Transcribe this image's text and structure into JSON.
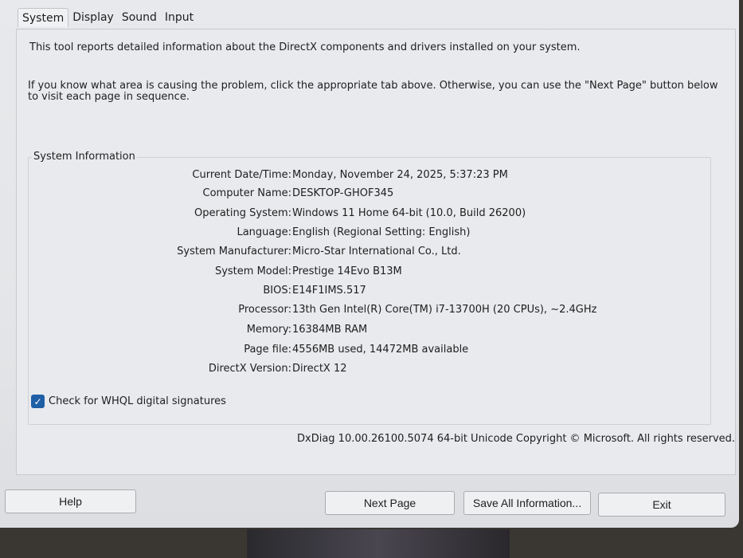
{
  "tabs": [
    {
      "label": "System"
    },
    {
      "label": "Display"
    },
    {
      "label": "Sound"
    },
    {
      "label": "Input"
    }
  ],
  "intro": {
    "line1": "This tool reports detailed information about the DirectX components and drivers installed on your system.",
    "line2": "If you know what area is causing the problem, click the appropriate tab above.  Otherwise, you can use the \"Next Page\" button below to visit each page in sequence."
  },
  "system_info": {
    "title": "System Information",
    "rows": [
      {
        "label": "Current Date/Time:",
        "value": "Monday, November 24, 2025, 5:37:23 PM"
      },
      {
        "label": "Computer Name:",
        "value": "DESKTOP-GHOF345"
      },
      {
        "label": "Operating System:",
        "value": "Windows 11 Home 64-bit (10.0, Build 26200)"
      },
      {
        "label": "Language:",
        "value": "English (Regional Setting: English)"
      },
      {
        "label": "System Manufacturer:",
        "value": "Micro-Star International Co., Ltd."
      },
      {
        "label": "System Model:",
        "value": "Prestige 14Evo B13M"
      },
      {
        "label": "BIOS:",
        "value": "E14F1IMS.517"
      },
      {
        "label": "Processor:",
        "value": "13th Gen Intel(R) Core(TM) i7-13700H (20 CPUs), ~2.4GHz"
      },
      {
        "label": "Memory:",
        "value": "16384MB RAM"
      },
      {
        "label": "Page file:",
        "value": "4556MB used, 14472MB available"
      },
      {
        "label": "DirectX Version:",
        "value": "DirectX 12"
      }
    ]
  },
  "whql": {
    "label": "Check for WHQL digital signatures",
    "checked": true
  },
  "copyright": "DxDiag 10.00.26100.5074 64-bit Unicode  Copyright © Microsoft. All rights reserved.",
  "buttons": {
    "help": "Help",
    "next": "Next Page",
    "save": "Save All Information...",
    "exit": "Exit"
  },
  "colors": {
    "accent": "#1f5fa6"
  }
}
